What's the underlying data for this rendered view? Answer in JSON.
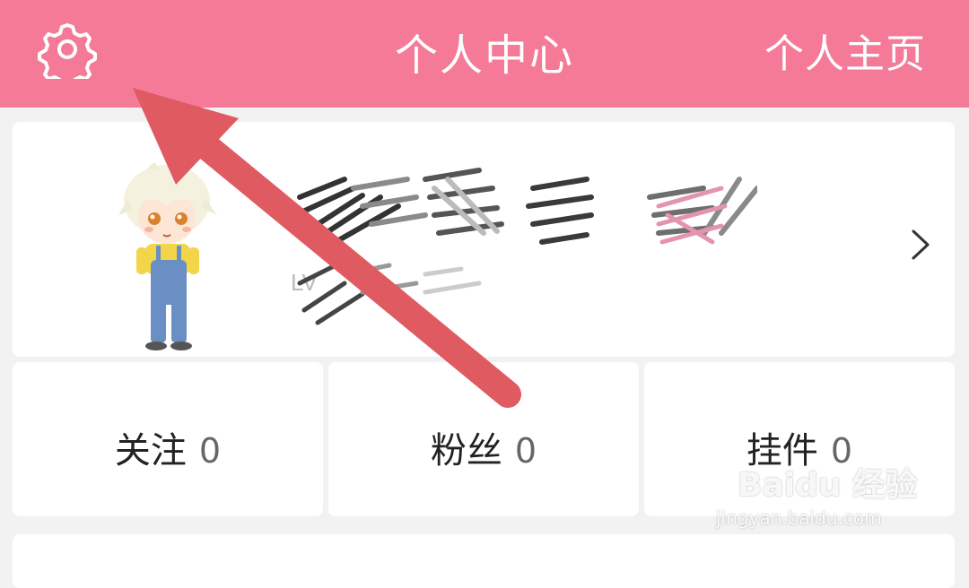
{
  "header": {
    "title": "个人中心",
    "right_link": "个人主页",
    "settings_icon": "gear-icon",
    "bg_color": "#f47a98"
  },
  "profile": {
    "chevron_icon": "chevron-right-icon",
    "level_text": "LV"
  },
  "stats": [
    {
      "label": "关注",
      "value": "0"
    },
    {
      "label": "粉丝",
      "value": "0"
    },
    {
      "label": "挂件",
      "value": "0"
    }
  ],
  "annotation": {
    "arrow_color": "#e05a62"
  },
  "watermark": {
    "logo": "Baidu 经验",
    "url": "jingyan.baidu.com"
  }
}
